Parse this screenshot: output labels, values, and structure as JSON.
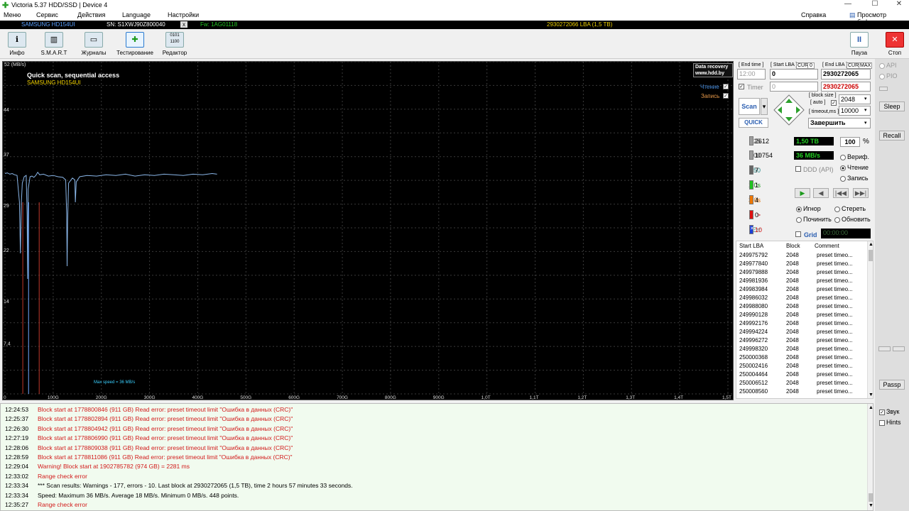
{
  "window": {
    "title": "Victoria 5.37 HDD/SSD | Device 4",
    "min": "—",
    "max": "☐",
    "close": "✕"
  },
  "menu": {
    "items": [
      "Меню",
      "Сервис",
      "Действия",
      "Language",
      "Настройки"
    ],
    "right1": "Справка",
    "right2": "Просмотр буфера"
  },
  "infobar": {
    "model": "SAMSUNG HD154UI",
    "sn": "SN: S1XWJ90Z800040",
    "x": "x",
    "fw": "Fw: 1AG01118",
    "lba": "2930272066 LBA (1,5 TB)"
  },
  "toolbar": {
    "info": "Инфо",
    "smart": "S.M.A.R.T",
    "logs": "Журналы",
    "test": "Тестирование",
    "editor": "Редактор",
    "pause": "Пауза",
    "stop": "Стоп"
  },
  "graph": {
    "title": "Quick scan, sequential access",
    "model": "SAMSUNG HD154UI",
    "yunit": "52 (MB/s)",
    "yticks": [
      "44",
      "37",
      "29",
      "22",
      "14",
      "7,4"
    ],
    "xticks": [
      "0",
      "100G",
      "200G",
      "300G",
      "400G",
      "500G",
      "600G",
      "700G",
      "800G",
      "900G",
      "1,0T",
      "1,1T",
      "1,2T",
      "1,3T",
      "1,4T",
      "1,5T"
    ],
    "read_label": "Чтение",
    "write_label": "Запись",
    "logo1": "Data recovery",
    "logo2": "www.hdd.by",
    "maxspeed": "Max speed = 36 MB/s",
    "colors": {
      "line": "#8ab6e8",
      "error": "#c0392b",
      "grid": "#3a3a3a"
    }
  },
  "controls": {
    "end_time": "[ End time ]",
    "start_lba_lbl": "[ Start LBA ]",
    "cur": "CUR",
    "zero": "0",
    "end_lba_lbl": "[ End LBA ]",
    "max": "MAX",
    "time_val": "12:00",
    "start_lba": "0",
    "end_lba": "2930272065",
    "timer": "Timer",
    "timer_val": "0",
    "end_lba2": "2930272065",
    "scan": "Scan",
    "quick": "QUICK",
    "block_size": "[ block size ]",
    "auto": "[ auto ]",
    "timeout": "[ timeout,ms ]",
    "block_val": "2048",
    "timeout_val": "10000",
    "finish": "Завершить"
  },
  "stats": [
    {
      "label": "25",
      "count": "2612",
      "color": "#9e9e9e"
    },
    {
      "label": "100",
      "count": "10754",
      "color": "#9e9e9e"
    },
    {
      "label": "250",
      "count": "7",
      "color": "#666"
    },
    {
      "label": "1,0s",
      "count": "1",
      "color": "#21c421"
    },
    {
      "label": "3,0s",
      "count": "4",
      "color": "#f07800"
    },
    {
      "label": ">",
      "count": "0",
      "color": "#e01010"
    },
    {
      "label": "Err",
      "count": "10",
      "color": "#1c3fd8"
    }
  ],
  "status": {
    "size": "1,50 TB",
    "percent": "100",
    "pct": "%",
    "speed": "36 MB/s",
    "ddd": "DDD (API)",
    "verify": "Вериф.",
    "read": "Чтение",
    "write": "Запись",
    "ignore": "Игнор",
    "erase": "Стереть",
    "fix": "Починить",
    "update": "Обновить",
    "grid": "Grid",
    "timer_disp": "00:00:00"
  },
  "table": {
    "headers": [
      "Start LBA",
      "Block",
      "Comment"
    ],
    "rows": [
      [
        "249975792",
        "2048",
        "preset timeo..."
      ],
      [
        "249977840",
        "2048",
        "preset timeo..."
      ],
      [
        "249979888",
        "2048",
        "preset timeo..."
      ],
      [
        "249981936",
        "2048",
        "preset timeo..."
      ],
      [
        "249983984",
        "2048",
        "preset timeo..."
      ],
      [
        "249986032",
        "2048",
        "preset timeo..."
      ],
      [
        "249988080",
        "2048",
        "preset timeo..."
      ],
      [
        "249990128",
        "2048",
        "preset timeo..."
      ],
      [
        "249992176",
        "2048",
        "preset timeo..."
      ],
      [
        "249994224",
        "2048",
        "preset timeo..."
      ],
      [
        "249996272",
        "2048",
        "preset timeo..."
      ],
      [
        "249998320",
        "2048",
        "preset timeo..."
      ],
      [
        "250000368",
        "2048",
        "preset timeo..."
      ],
      [
        "250002416",
        "2048",
        "preset timeo..."
      ],
      [
        "250004464",
        "2048",
        "preset timeo..."
      ],
      [
        "250006512",
        "2048",
        "preset timeo..."
      ],
      [
        "250008560",
        "2048",
        "preset timeo..."
      ]
    ]
  },
  "side": {
    "api": "API",
    "pio": "PIO",
    "sleep": "Sleep",
    "recall": "Recall",
    "passp": "Passp",
    "sound": "Звук",
    "hints": "Hints"
  },
  "log": [
    {
      "time": "12:24:53",
      "text": "Block start at 1778800846 (911 GB) Read error: preset timeout limit \"Ошибка в данных (CRC)\"",
      "red": true
    },
    {
      "time": "12:25:37",
      "text": "Block start at 1778802894 (911 GB) Read error: preset timeout limit \"Ошибка в данных (CRC)\"",
      "red": true
    },
    {
      "time": "12:26:30",
      "text": "Block start at 1778804942 (911 GB) Read error: preset timeout limit \"Ошибка в данных (CRC)\"",
      "red": true
    },
    {
      "time": "12:27:19",
      "text": "Block start at 1778806990 (911 GB) Read error: preset timeout limit \"Ошибка в данных (CRC)\"",
      "red": true
    },
    {
      "time": "12:28:06",
      "text": "Block start at 1778809038 (911 GB) Read error: preset timeout limit \"Ошибка в данных (CRC)\"",
      "red": true
    },
    {
      "time": "12:28:59",
      "text": "Block start at 1778811086 (911 GB) Read error: preset timeout limit \"Ошибка в данных (CRC)\"",
      "red": true
    },
    {
      "time": "12:29:04",
      "text": "Warning! Block start at 1902785782 (974 GB)  = 2281 ms",
      "red": true
    },
    {
      "time": "12:33:02",
      "text": "Range check error",
      "red": true
    },
    {
      "time": "12:33:34",
      "text": "*** Scan results: Warnings - 177, errors - 10. Last block at 2930272065 (1,5 TB), time 2 hours 57 minutes 33 seconds.",
      "red": false
    },
    {
      "time": "12:33:34",
      "text": "Speed: Maximum 36 MB/s. Average 18 MB/s. Minimum 0 MB/s. 448 points.",
      "red": false
    },
    {
      "time": "12:35:27",
      "text": "Range check error",
      "red": true
    }
  ]
}
